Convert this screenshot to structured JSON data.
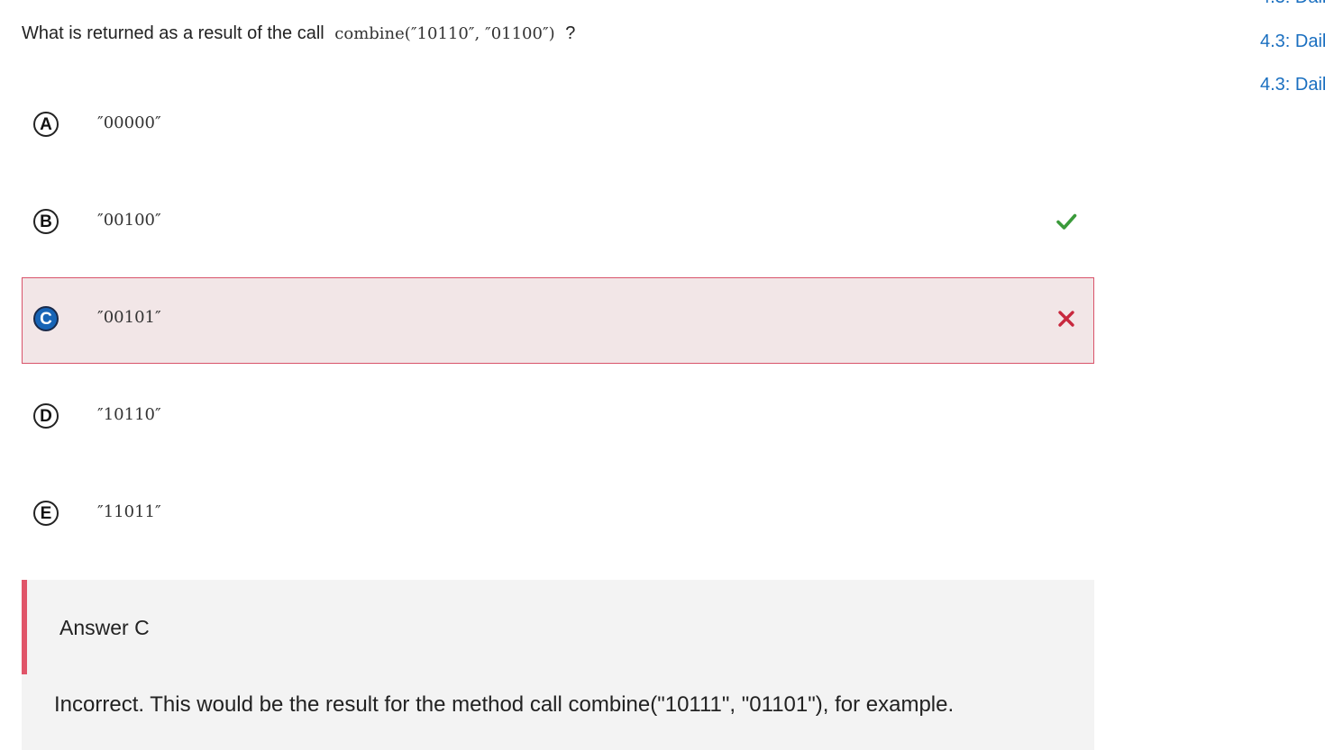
{
  "question": {
    "prefix": "What is returned as a result of the call",
    "code": "combine(″10110″, ″01100″)",
    "suffix": "?"
  },
  "side_nav": {
    "links": [
      "4.3: Dail",
      "4.3: Dail",
      "4.3: Dail"
    ]
  },
  "choices": [
    {
      "letter": "A",
      "value": "″00000″"
    },
    {
      "letter": "B",
      "value": "″00100″"
    },
    {
      "letter": "C",
      "value": "″00101″"
    },
    {
      "letter": "D",
      "value": "″10110″"
    },
    {
      "letter": "E",
      "value": "″11011″"
    }
  ],
  "feedback": {
    "title": "Answer C",
    "text": "Incorrect. This would be the result for the method call combine(\"10111\", \"01101\"), for example."
  },
  "icons": {
    "correct": "check-icon",
    "incorrect": "close-icon"
  },
  "colors": {
    "link": "#1a6fc0",
    "correct": "#3a9a3a",
    "incorrect": "#c8283e",
    "selected_bg": "#f2e6e7",
    "selected_border": "#d9536a",
    "selected_letter_bg": "#1764b6",
    "feedback_bar": "#e05468",
    "feedback_bg": "#f3f3f3"
  }
}
